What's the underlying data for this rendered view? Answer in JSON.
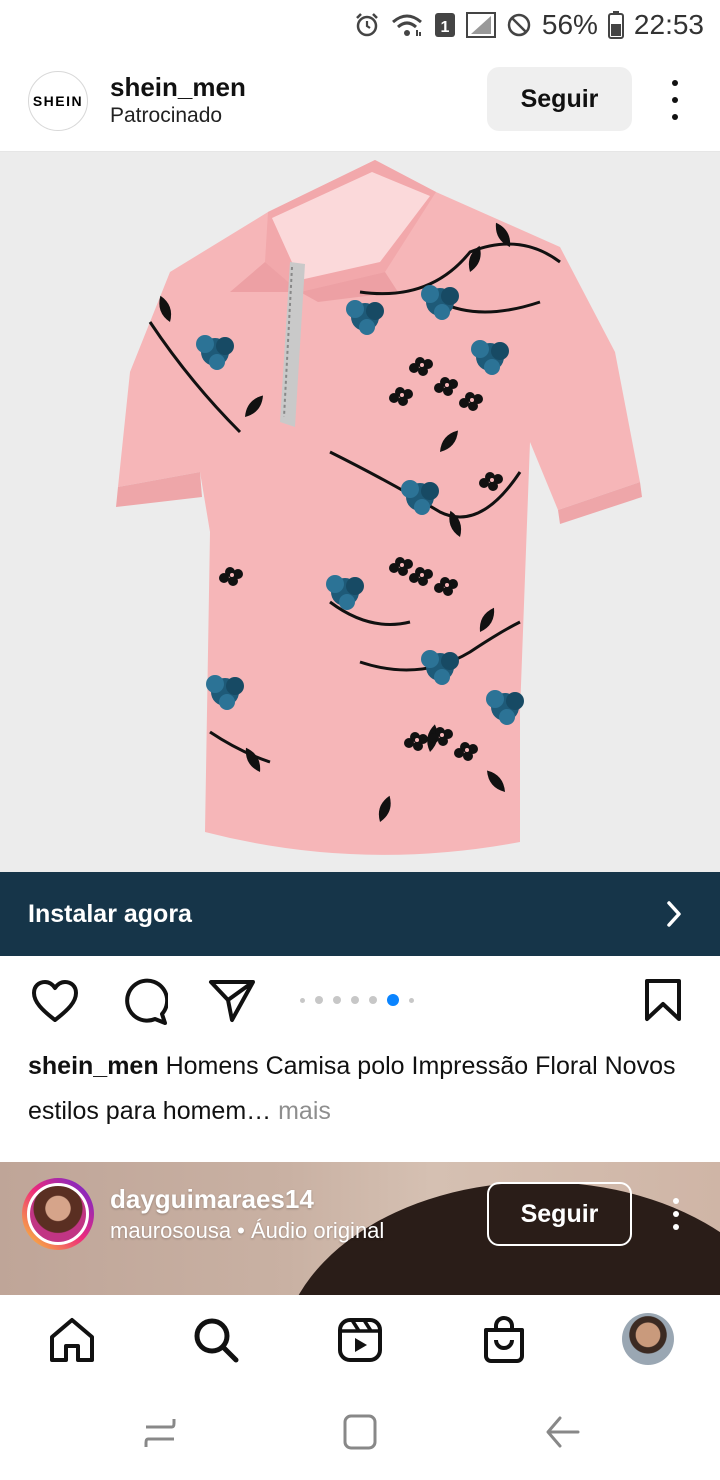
{
  "status_bar": {
    "battery": "56%",
    "time": "22:53",
    "sim_badge": "1",
    "icons": [
      "alarm-icon",
      "wifi-icon",
      "sim-icon",
      "signal-icon",
      "do-not-disturb-icon",
      "battery-icon"
    ]
  },
  "post": {
    "avatar_logo": "SHEIN",
    "username": "shein_men",
    "subtitle": "Patrocinado",
    "follow_label": "Seguir",
    "cta_label": "Instalar agora",
    "carousel": {
      "count": 7,
      "active_index": 5
    },
    "caption_user": "shein_men",
    "caption_text": "Homens Camisa polo Impressão Floral Novos estilos para homem",
    "caption_ellipsis": "…",
    "caption_more": "mais"
  },
  "next_post": {
    "username": "dayguimaraes14",
    "subtitle": "maurosousa • Áudio original",
    "follow_label": "Seguir"
  },
  "bottom_nav": {
    "items": [
      "home-icon",
      "search-icon",
      "reels-icon",
      "shop-icon",
      "profile-avatar"
    ]
  },
  "colors": {
    "cta_background": "#163549",
    "carousel_active": "#0a84ff",
    "shirt_pink": "#f6b6b8",
    "flower_blue": "#1e5a78"
  }
}
